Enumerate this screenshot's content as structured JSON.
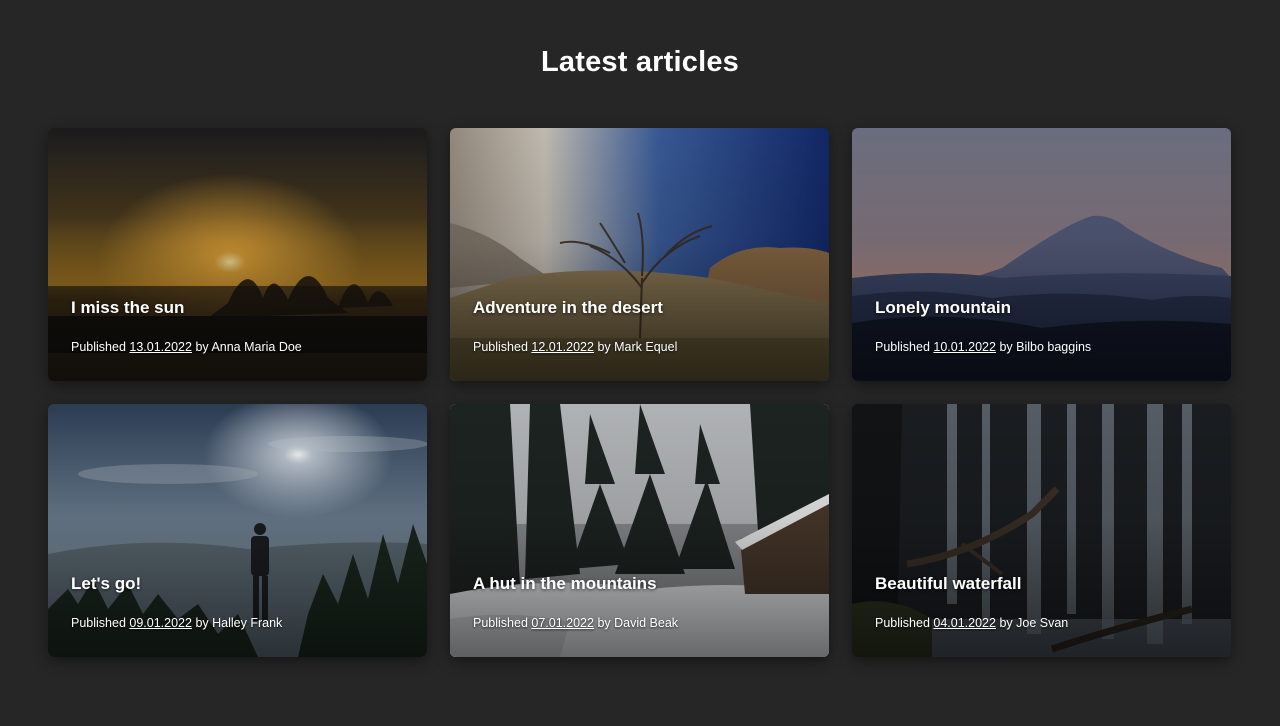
{
  "page": {
    "title": "Latest articles"
  },
  "articles": [
    {
      "title": "I miss the sun",
      "published_label": "Published",
      "date": "13.01.2022",
      "by_label": "by",
      "author": "Anna Maria Doe"
    },
    {
      "title": "Adventure in the desert",
      "published_label": "Published",
      "date": "12.01.2022",
      "by_label": "by",
      "author": "Mark Equel"
    },
    {
      "title": "Lonely mountain",
      "published_label": "Published",
      "date": "10.01.2022",
      "by_label": "by",
      "author": "Bilbo baggins"
    },
    {
      "title": "Let's go!",
      "published_label": "Published",
      "date": "09.01.2022",
      "by_label": "by",
      "author": "Halley Frank"
    },
    {
      "title": "A hut in the mountains",
      "published_label": "Published",
      "date": "07.01.2022",
      "by_label": "by",
      "author": "David Beak"
    },
    {
      "title": "Beautiful waterfall",
      "published_label": "Published",
      "date": "04.01.2022",
      "by_label": "by",
      "author": "Joe Svan"
    }
  ],
  "colors": {
    "background": "#262626",
    "text": "#ffffff"
  }
}
